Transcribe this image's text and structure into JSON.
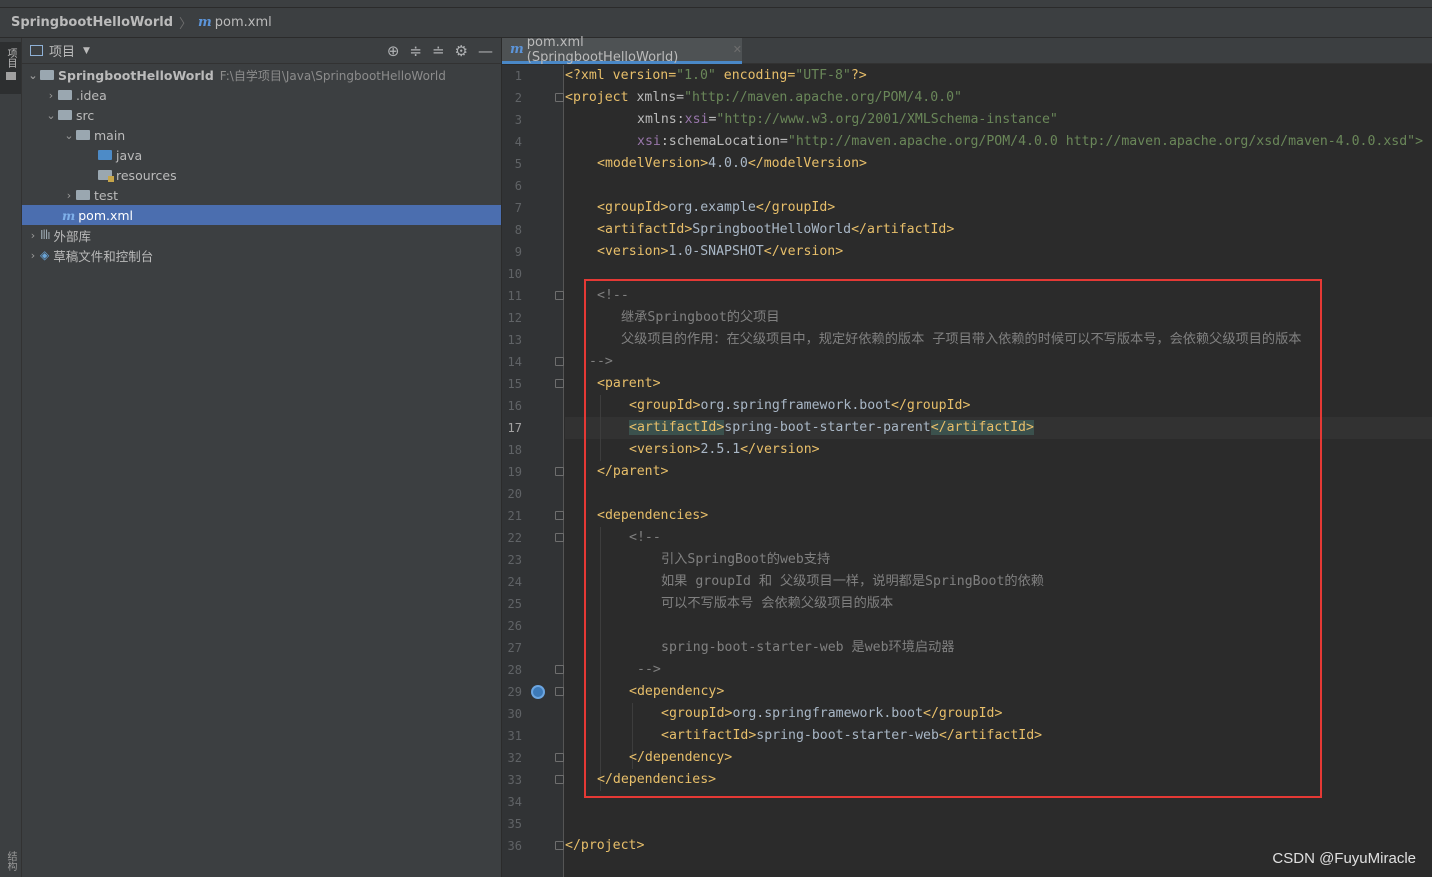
{
  "navbar": {
    "project": "SpringbootHelloWorld",
    "separator": "〉",
    "file_icon": "m",
    "file": "pom.xml"
  },
  "left_strip": {
    "project_tab": "项目",
    "structure_tab": "结构"
  },
  "project_panel": {
    "title": "项目",
    "tools": [
      "⊕",
      "≑",
      "≐",
      "⚙",
      "—"
    ],
    "tree": {
      "root": {
        "name": "SpringbootHelloWorld",
        "path": "F:\\自学项目\\Java\\SpringbootHelloWorld"
      },
      "idea": ".idea",
      "src": "src",
      "main": "main",
      "java": "java",
      "resources": "resources",
      "test": "test",
      "pom": "pom.xml",
      "external_libs": "外部库",
      "scratches": "草稿文件和控制台"
    }
  },
  "editor": {
    "tab_label": "pom.xml (SpringbootHelloWorld)",
    "current_line": 17,
    "line_numbers": [
      "1",
      "2",
      "3",
      "4",
      "5",
      "6",
      "7",
      "8",
      "9",
      "10",
      "11",
      "12",
      "13",
      "14",
      "15",
      "16",
      "17",
      "18",
      "19",
      "20",
      "21",
      "22",
      "23",
      "24",
      "25",
      "26",
      "27",
      "28",
      "29",
      "30",
      "31",
      "32",
      "33",
      "34",
      "35",
      "36"
    ]
  },
  "code": {
    "l1_a": "<?xml version=",
    "l1_b": "\"1.0\"",
    "l1_c": " encoding=",
    "l1_d": "\"UTF-8\"",
    "l1_e": "?>",
    "l2_tag": "<project",
    "l2_attr": " xmlns=",
    "l2_val": "\"http://maven.apache.org/POM/4.0.0\"",
    "l3_attr": "xmlns:",
    "l3_ns": "xsi",
    "l3_eq": "=",
    "l3_val": "\"http://www.w3.org/2001/XMLSchema-instance\"",
    "l4_ns": "xsi",
    "l4_attr": ":schemaLocation=",
    "l4_val": "\"http://maven.apache.org/POM/4.0.0 http://maven.apache.org/xsd/maven-4.0.0.xsd\">",
    "l5_open": "<modelVersion>",
    "l5_text": "4.0.0",
    "l5_close": "</modelVersion>",
    "l7_open": "<groupId>",
    "l7_text": "org.example",
    "l7_close": "</groupId>",
    "l8_open": "<artifactId>",
    "l8_text": "SpringbootHelloWorld",
    "l8_close": "</artifactId>",
    "l9_open": "<version>",
    "l9_text": "1.0-SNAPSHOT",
    "l9_close": "</version>",
    "l11": "<!--",
    "l12": "继承Springboot的父项目",
    "l13": "父级项目的作用：在父级项目中，规定好依赖的版本 子项目带入依赖的时候可以不写版本号，会依赖父级项目的版本",
    "l14": "-->",
    "l15": "<parent>",
    "l16_open": "<groupId>",
    "l16_text": "org.springframework.boot",
    "l16_close": "</groupId>",
    "l17_open": "<artifactId>",
    "l17_text": "spring-boot-starter-parent",
    "l17_close": "</artifactId>",
    "l18_open": "<version>",
    "l18_text": "2.5.1",
    "l18_close": "</version>",
    "l19": "</parent>",
    "l21": "<dependencies>",
    "l22": "<!--",
    "l23": "引入SpringBoot的web支持",
    "l24": "如果 groupId 和 父级项目一样，说明都是SpringBoot的依赖",
    "l25": "可以不写版本号 会依赖父级项目的版本",
    "l27": "spring-boot-starter-web 是web环境启动器",
    "l28": "-->",
    "l29": "<dependency>",
    "l30_open": "<groupId>",
    "l30_text": "org.springframework.boot",
    "l30_close": "</groupId>",
    "l31_open": "<artifactId>",
    "l31_text": "spring-boot-starter-web",
    "l31_close": "</artifactId>",
    "l32": "</dependency>",
    "l33": "</dependencies>",
    "l36": "</project>"
  },
  "colors": {
    "accent": "#4b6eaf",
    "highlight_box": "#e53935",
    "tag": "#e8bf6a",
    "string": "#6a8759",
    "comment": "#808080"
  },
  "watermark": "CSDN @FuyuMiracle"
}
